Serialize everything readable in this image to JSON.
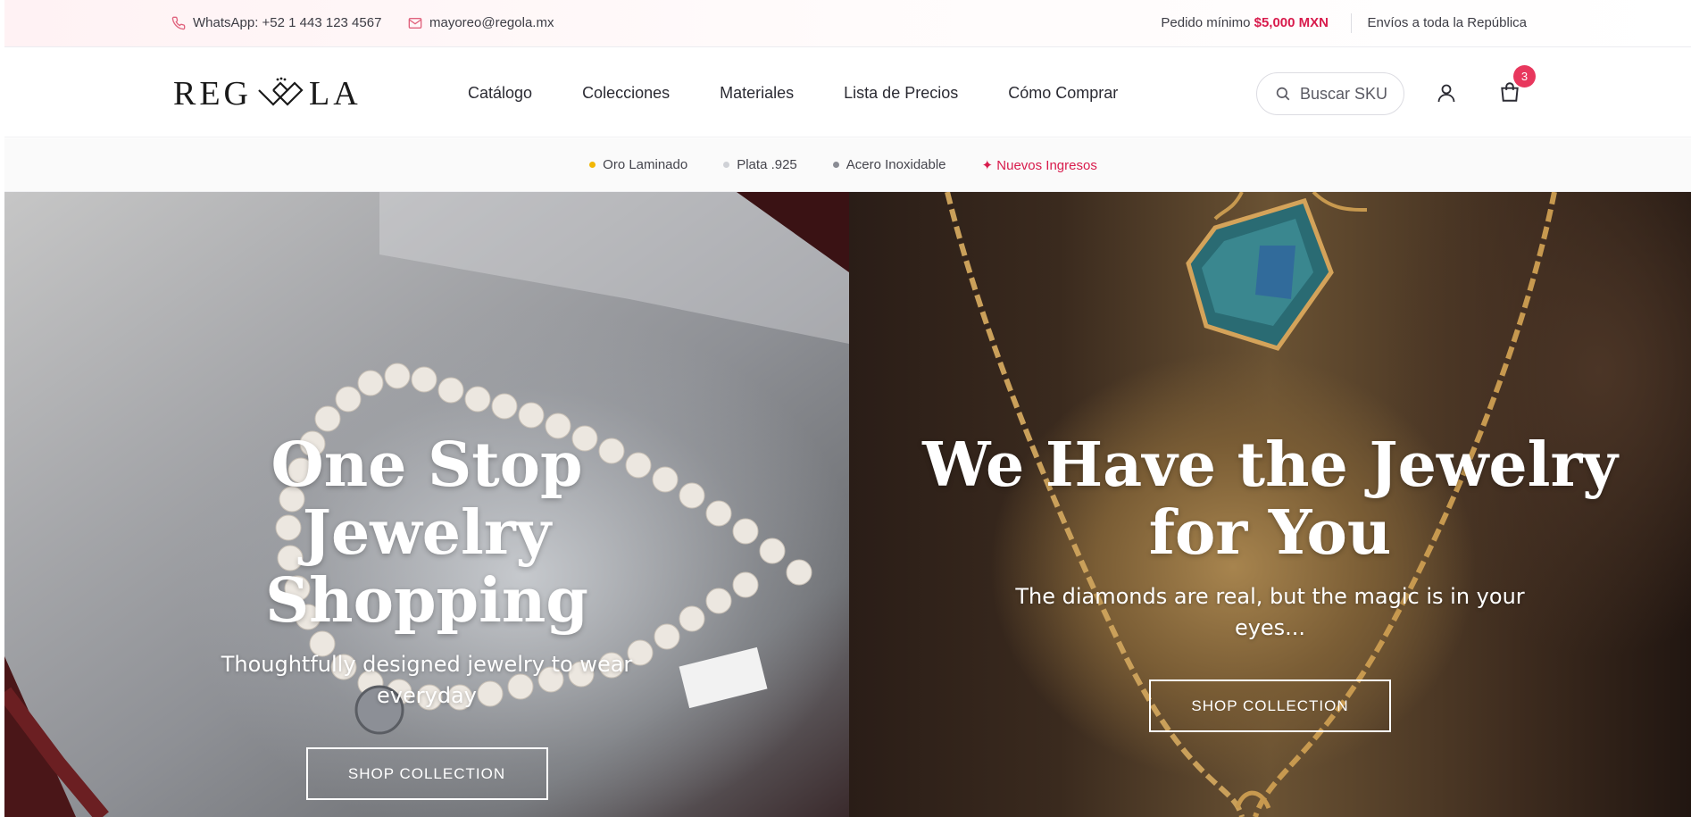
{
  "topbar": {
    "whatsapp": "WhatsApp: +52 1 443 123 4567",
    "email": "mayoreo@regola.mx",
    "min_order_label": "Pedido mínimo",
    "min_order_amount": "$5,000 MXN",
    "shipping": "Envíos a toda la República"
  },
  "header": {
    "logo_left": "REG",
    "logo_right": "LA",
    "nav": [
      "Catálogo",
      "Colecciones",
      "Materiales",
      "Lista de Precios",
      "Cómo Comprar"
    ],
    "search_placeholder": "Buscar SKU",
    "cart_count": "3"
  },
  "categories": [
    {
      "label": "Oro Laminado",
      "dot_color": "#f2b705"
    },
    {
      "label": "Plata .925",
      "dot_color": "#cfd1d6"
    },
    {
      "label": "Acero Inoxidable",
      "dot_color": "#8a8c94"
    },
    {
      "label": "✦ Nuevos Ingresos",
      "color": "#d81b4c"
    }
  ],
  "hero": [
    {
      "title": "One Stop Jewelry Shopping",
      "subtitle": "Thoughtfully designed jewelry to wear everyday",
      "button": "SHOP COLLECTION"
    },
    {
      "title": "We Have the Jewelry for You",
      "subtitle": "The diamonds are real, but the magic is in your eyes...",
      "button": "SHOP COLLECTION"
    }
  ],
  "colors": {
    "accent": "#d81b4c",
    "badge": "#e8375d"
  }
}
